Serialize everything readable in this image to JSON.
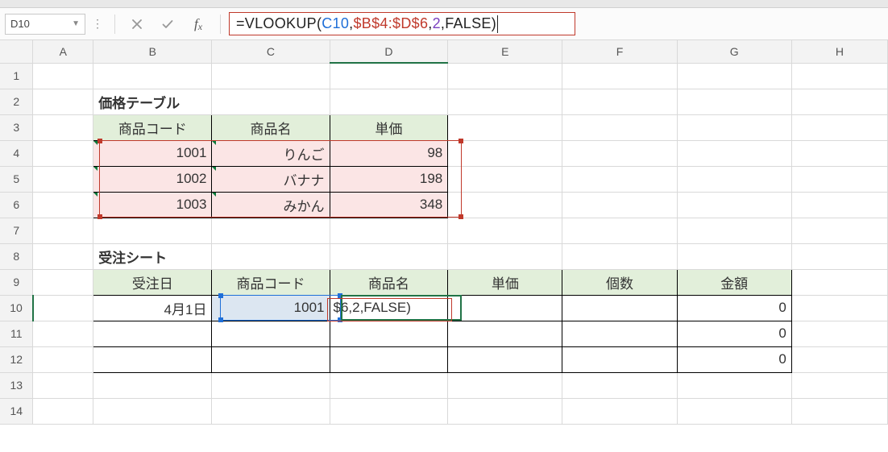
{
  "namebox": "D10",
  "formula": {
    "parts": [
      {
        "cls": "t-black",
        "text": "=VLOOKUP("
      },
      {
        "cls": "t-blue",
        "text": "C10"
      },
      {
        "cls": "t-black",
        "text": ","
      },
      {
        "cls": "t-red",
        "text": "$B$4:$D$6"
      },
      {
        "cls": "t-black",
        "text": ","
      },
      {
        "cls": "t-purple",
        "text": "2"
      },
      {
        "cls": "t-black",
        "text": ",FALSE)"
      }
    ]
  },
  "columns": [
    "A",
    "B",
    "C",
    "D",
    "E",
    "F",
    "G",
    "H"
  ],
  "rows": [
    "1",
    "2",
    "3",
    "4",
    "5",
    "6",
    "7",
    "8",
    "9",
    "10",
    "11",
    "12",
    "13",
    "14"
  ],
  "price_table": {
    "title": "価格テーブル",
    "headers": {
      "code": "商品コード",
      "name": "商品名",
      "price": "単価"
    },
    "rows": [
      {
        "code": "1001",
        "name": "りんご",
        "price": "98"
      },
      {
        "code": "1002",
        "name": "バナナ",
        "price": "198"
      },
      {
        "code": "1003",
        "name": "みかん",
        "price": "348"
      }
    ]
  },
  "order_sheet": {
    "title": "受注シート",
    "headers": {
      "date": "受注日",
      "code": "商品コード",
      "name": "商品名",
      "price": "単価",
      "qty": "個数",
      "amount": "金額"
    },
    "rows": [
      {
        "date": "4月1日",
        "code": "1001",
        "name_display": "$6,2,FALSE)",
        "price": "",
        "qty": "",
        "amount": "0"
      },
      {
        "date": "",
        "code": "",
        "name_display": "",
        "price": "",
        "qty": "",
        "amount": "0"
      },
      {
        "date": "",
        "code": "",
        "name_display": "",
        "price": "",
        "qty": "",
        "amount": "0"
      }
    ]
  }
}
